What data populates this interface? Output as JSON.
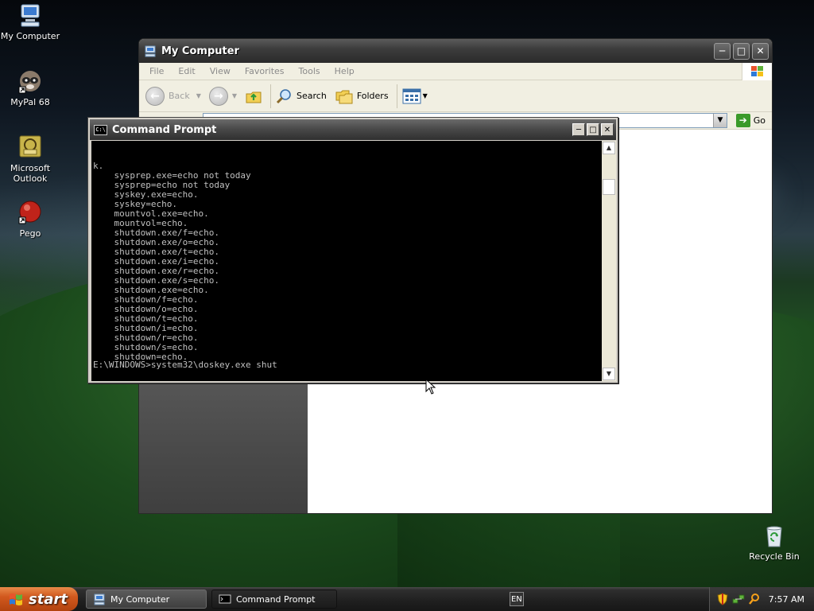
{
  "desktop": {
    "icons": [
      {
        "label": "My Computer"
      },
      {
        "label": "MyPal 68"
      },
      {
        "label": "Microsoft Outlook"
      },
      {
        "label": "Pego"
      },
      {
        "label": "Recycle Bin"
      }
    ]
  },
  "explorer": {
    "title": "My Computer",
    "menu": [
      "File",
      "Edit",
      "View",
      "Favorites",
      "Tools",
      "Help"
    ],
    "toolbar": {
      "back_label": "Back",
      "search_label": "Search",
      "folders_label": "Folders"
    },
    "address": {
      "value": "",
      "go_label": "Go"
    }
  },
  "cmd": {
    "title": "Command Prompt",
    "lines": [
      "k.",
      "    sysprep.exe=echo not today",
      "    sysprep=echo not today",
      "    syskey.exe=echo.",
      "    syskey=echo.",
      "    mountvol.exe=echo.",
      "    mountvol=echo.",
      "    shutdown.exe/f=echo.",
      "    shutdown.exe/o=echo.",
      "    shutdown.exe/t=echo.",
      "    shutdown.exe/i=echo.",
      "    shutdown.exe/r=echo.",
      "    shutdown.exe/s=echo.",
      "    shutdown.exe=echo.",
      "    shutdown/f=echo.",
      "    shutdown/o=echo.",
      "    shutdown/t=echo.",
      "    shutdown/i=echo.",
      "    shutdown/r=echo.",
      "    shutdown/s=echo.",
      "    shutdown=echo."
    ],
    "prompt": "E:\\WINDOWS>system32\\doskey.exe shut"
  },
  "taskbar": {
    "start_label": "start",
    "items": [
      {
        "label": "My Computer"
      },
      {
        "label": "Command Prompt"
      }
    ],
    "tray": {
      "language": "EN",
      "time": "7:57 AM"
    }
  },
  "colors": {
    "start_orange": "#d2591e",
    "console_bg": "#000000",
    "console_text": "#c0c0c0"
  }
}
